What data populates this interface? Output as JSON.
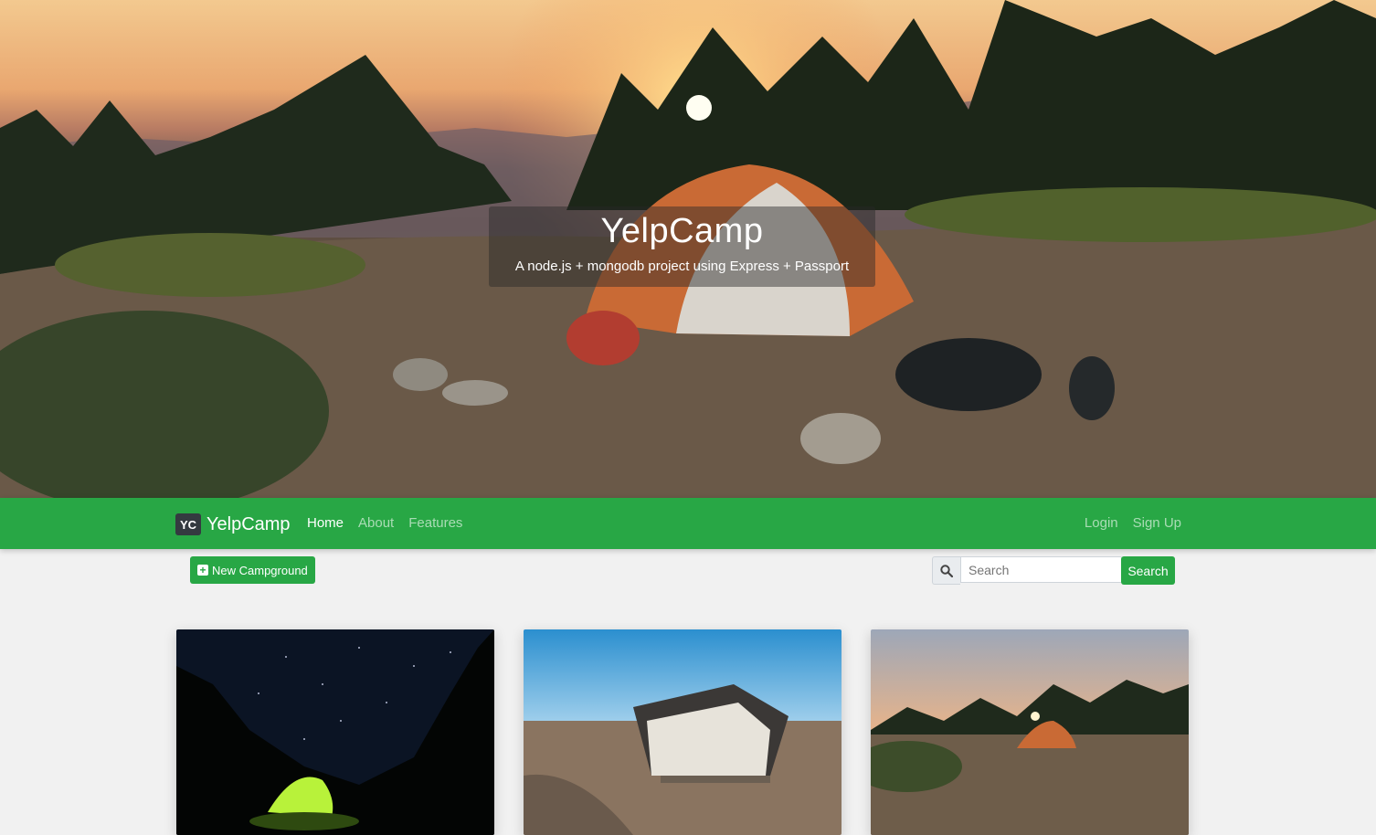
{
  "hero": {
    "title": "YelpCamp",
    "subtitle": "A node.js + mongodb project using Express + Passport"
  },
  "navbar": {
    "brand_logo": "YC",
    "brand_name": "YelpCamp",
    "links": [
      "Home",
      "About",
      "Features"
    ],
    "active": "Home",
    "right_links": [
      "Login",
      "Sign Up"
    ],
    "color": "#28a745"
  },
  "toolbar": {
    "new_label": "New Campground",
    "search_placeholder": "Search",
    "search_button": "Search",
    "icons": [
      "plus-square-icon",
      "search-icon"
    ]
  },
  "cards": [
    {
      "scene": "night tent under stars"
    },
    {
      "scene": "canvas tent in desert"
    },
    {
      "scene": "tent at sunset"
    }
  ]
}
